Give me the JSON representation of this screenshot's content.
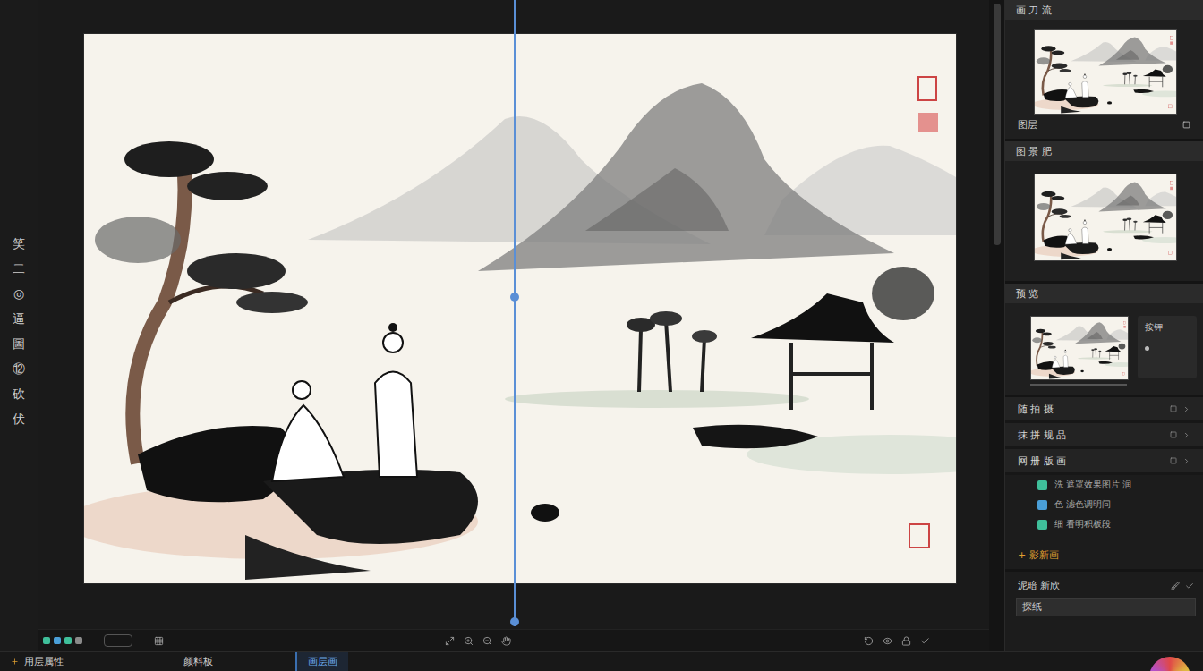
{
  "toolbar": {
    "tools": [
      "笑",
      "二",
      "◎",
      "逼",
      "圖",
      "⑫",
      "砍",
      "伏"
    ]
  },
  "panels": [
    {
      "title": "画 刀 流",
      "caption": "图层",
      "kind": "thumb"
    },
    {
      "title": "图 景 肥",
      "caption": "",
      "kind": "thumb"
    },
    {
      "title": "预 览",
      "caption": "按钾",
      "kind": "preview"
    }
  ],
  "groups": [
    {
      "label": "随 拍 摄"
    },
    {
      "label": "抹 拼 规 品"
    },
    {
      "label": "网 册 版 画"
    }
  ],
  "layers": [
    {
      "label": "洗 遮罩效果图片 润",
      "color": "#3fbf9a"
    },
    {
      "label": "色 滤色调明问",
      "color": "#4a9fd8"
    },
    {
      "label": "细 看明积板段",
      "color": "#3fbf9a"
    }
  ],
  "add_layer": "+ 影新画",
  "brush": {
    "title": "泥暗 新欣",
    "field": "探纸"
  },
  "footer_swatches": [
    {
      "color": "#3fbf9a"
    },
    {
      "color": "#4a9fd8"
    },
    {
      "color": "#3fbf9a"
    },
    {
      "color": "#8a8a8a"
    }
  ],
  "bottom_tabs": [
    {
      "label": "用层属性",
      "selected": false
    },
    {
      "label": "颜料板",
      "selected": false
    },
    {
      "label": "画层画",
      "selected": true
    }
  ]
}
